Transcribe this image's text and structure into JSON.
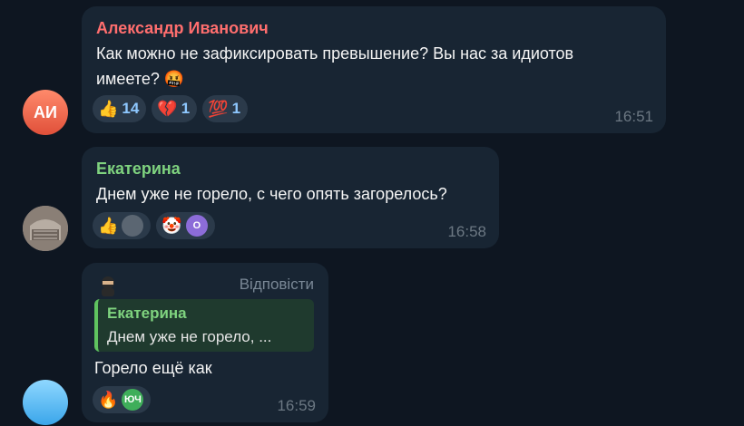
{
  "messages": [
    {
      "sender": "Александр Иванович",
      "sender_color": "#ff6e6e",
      "avatar_initials": "АИ",
      "text_line1": "Как можно не зафиксировать превышение? Вы нас за идиотов",
      "text_line2": "имеете? 🤬",
      "reactions": [
        {
          "emoji": "👍",
          "count": "14"
        },
        {
          "emoji": "💔",
          "count": "1"
        },
        {
          "emoji": "💯",
          "count": "1"
        }
      ],
      "time": "16:51"
    },
    {
      "sender": "Екатерина",
      "sender_color": "#7fd37f",
      "text": "Днем уже не горело, с чего опять загорелось?",
      "reactions": [
        {
          "emoji": "👍",
          "avatar": ""
        },
        {
          "emoji": "🤡",
          "avatar": "О"
        }
      ],
      "time": "16:58"
    },
    {
      "reply_label": "Відповісти",
      "quote_name": "Екатерина",
      "quote_text": "Днем уже не горело, ...",
      "text": "Горело ещё как",
      "reactions": [
        {
          "emoji": "🔥",
          "avatar": "ЮЧ"
        }
      ],
      "time": "16:59"
    }
  ]
}
